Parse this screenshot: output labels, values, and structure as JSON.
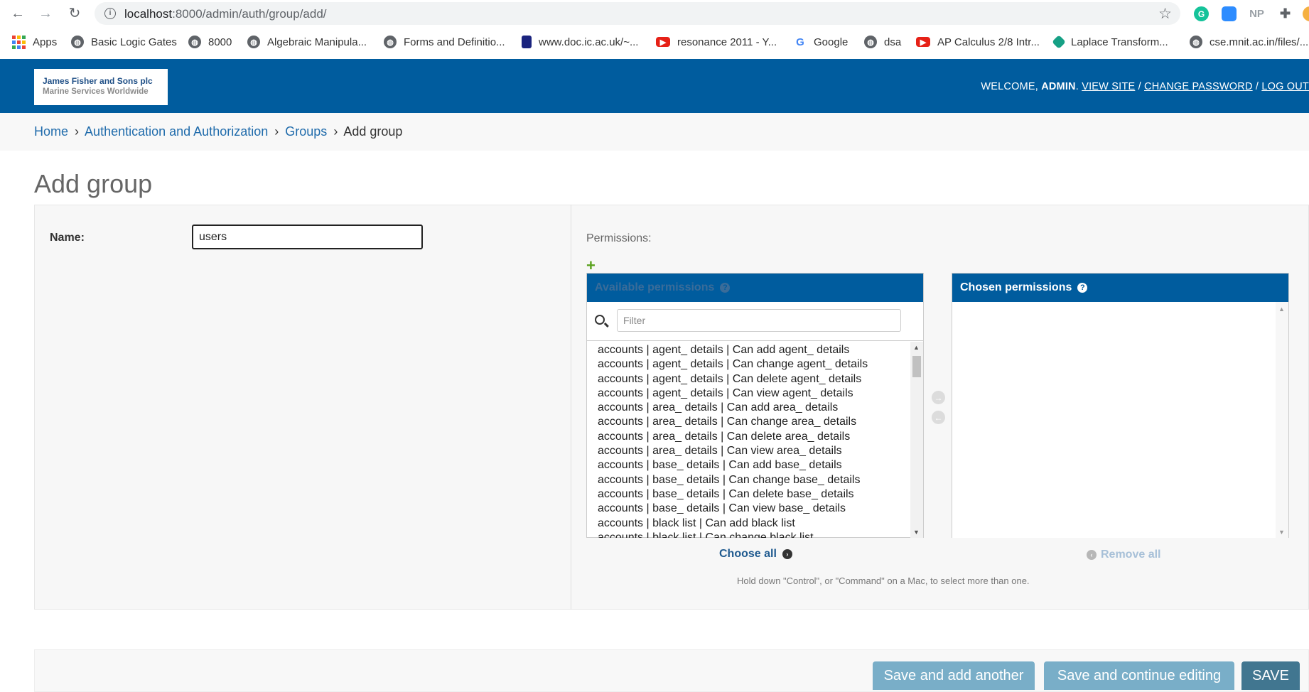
{
  "browser": {
    "url_host": "localhost",
    "url_path": ":8000/admin/auth/group/add/",
    "extensions": [
      "G",
      "",
      "NP",
      "",
      ""
    ]
  },
  "bookmarks": [
    {
      "label": "Apps",
      "icon": "apps-grid-icon"
    },
    {
      "label": "Basic Logic Gates",
      "icon": "globe-icon"
    },
    {
      "label": "8000",
      "icon": "globe-icon"
    },
    {
      "label": "Algebraic Manipula...",
      "icon": "globe-icon"
    },
    {
      "label": "Forms and Definitio...",
      "icon": "globe-icon"
    },
    {
      "label": "www.doc.ic.ac.uk/~...",
      "icon": "doc-icon"
    },
    {
      "label": "resonance 2011 - Y...",
      "icon": "youtube-icon"
    },
    {
      "label": "Google",
      "icon": "google-icon"
    },
    {
      "label": "dsa",
      "icon": "globe-icon"
    },
    {
      "label": "AP Calculus 2/8 Intr...",
      "icon": "youtube-icon"
    },
    {
      "label": "Laplace Transform...",
      "icon": "laplace-icon"
    },
    {
      "label": "cse.mnit.ac.in/files/...",
      "icon": "globe-icon"
    }
  ],
  "header": {
    "logo_line1": "James Fisher and Sons plc",
    "logo_line2": "Marine Services Worldwide",
    "welcome": "WELCOME,",
    "username": "ADMIN",
    "view_site": "VIEW SITE",
    "change_password": "CHANGE PASSWORD",
    "log_out": "LOG OUT",
    "sep": "/"
  },
  "breadcrumbs": {
    "home": "Home",
    "app": "Authentication and Authorization",
    "model": "Groups",
    "current": "Add group",
    "sep": "›"
  },
  "form": {
    "title": "Add group",
    "name_label": "Name:",
    "name_value": "users",
    "permissions_label": "Permissions:",
    "available_title": "Available permissions",
    "chosen_title": "Chosen permissions",
    "help_icon": "?",
    "filter_placeholder": "Filter",
    "available_options": [
      "accounts | agent_ details | Can add agent_ details",
      "accounts | agent_ details | Can change agent_ details",
      "accounts | agent_ details | Can delete agent_ details",
      "accounts | agent_ details | Can view agent_ details",
      "accounts | area_ details | Can add area_ details",
      "accounts | area_ details | Can change area_ details",
      "accounts | area_ details | Can delete area_ details",
      "accounts | area_ details | Can view area_ details",
      "accounts | base_ details | Can add base_ details",
      "accounts | base_ details | Can change base_ details",
      "accounts | base_ details | Can delete base_ details",
      "accounts | base_ details | Can view base_ details",
      "accounts | black list | Can add black list",
      "accounts | black list | Can change black list"
    ],
    "choose_all": "Choose all",
    "remove_all": "Remove all",
    "help_text": "Hold down \"Control\", or \"Command\" on a Mac, to select more than one."
  },
  "actions": {
    "save_add_another": "Save and add another",
    "save_continue": "Save and continue editing",
    "save": "SAVE"
  },
  "colors": {
    "header_blue": "#005c9e",
    "link_blue": "#1f6bab",
    "button_light": "#79aec8",
    "button_save": "#417690"
  }
}
